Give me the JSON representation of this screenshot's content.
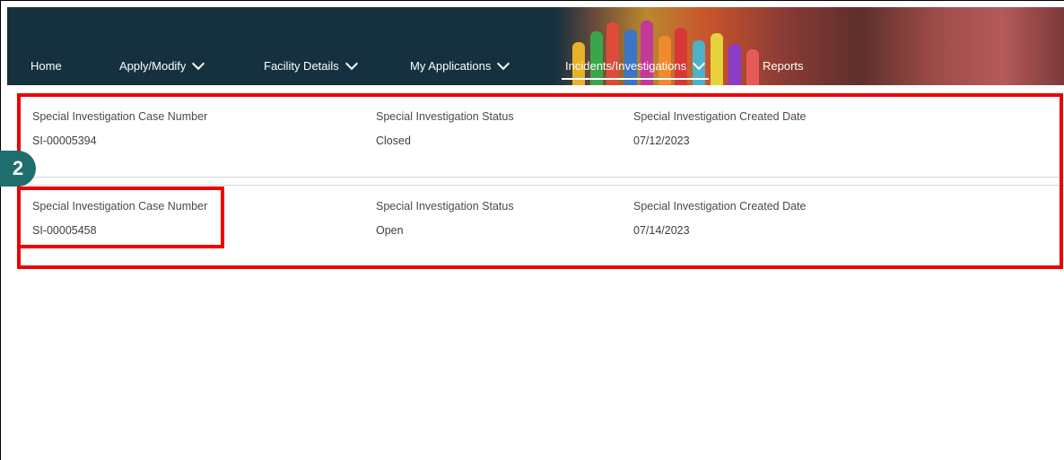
{
  "nav": {
    "items": [
      {
        "label": "Home"
      },
      {
        "label": "Apply/Modify"
      },
      {
        "label": "Facility Details"
      },
      {
        "label": "My Applications"
      },
      {
        "label": "Incidents/Investigations"
      },
      {
        "label": "Reports"
      }
    ]
  },
  "records": [
    {
      "case_number_label": "Special Investigation Case Number",
      "case_number": "SI-00005394",
      "status_label": "Special Investigation Status",
      "status": "Closed",
      "created_label": "Special Investigation Created Date",
      "created": "07/12/2023"
    },
    {
      "case_number_label": "Special Investigation Case Number",
      "case_number": "SI-00005458",
      "status_label": "Special Investigation Status",
      "status": "Open",
      "created_label": "Special Investigation Created Date",
      "created": "07/14/2023"
    }
  ],
  "step_badge": "2",
  "colors": {
    "nav_bg": "#15313f",
    "highlight_red": "#ee0000",
    "badge_teal": "#1f6e6e"
  }
}
